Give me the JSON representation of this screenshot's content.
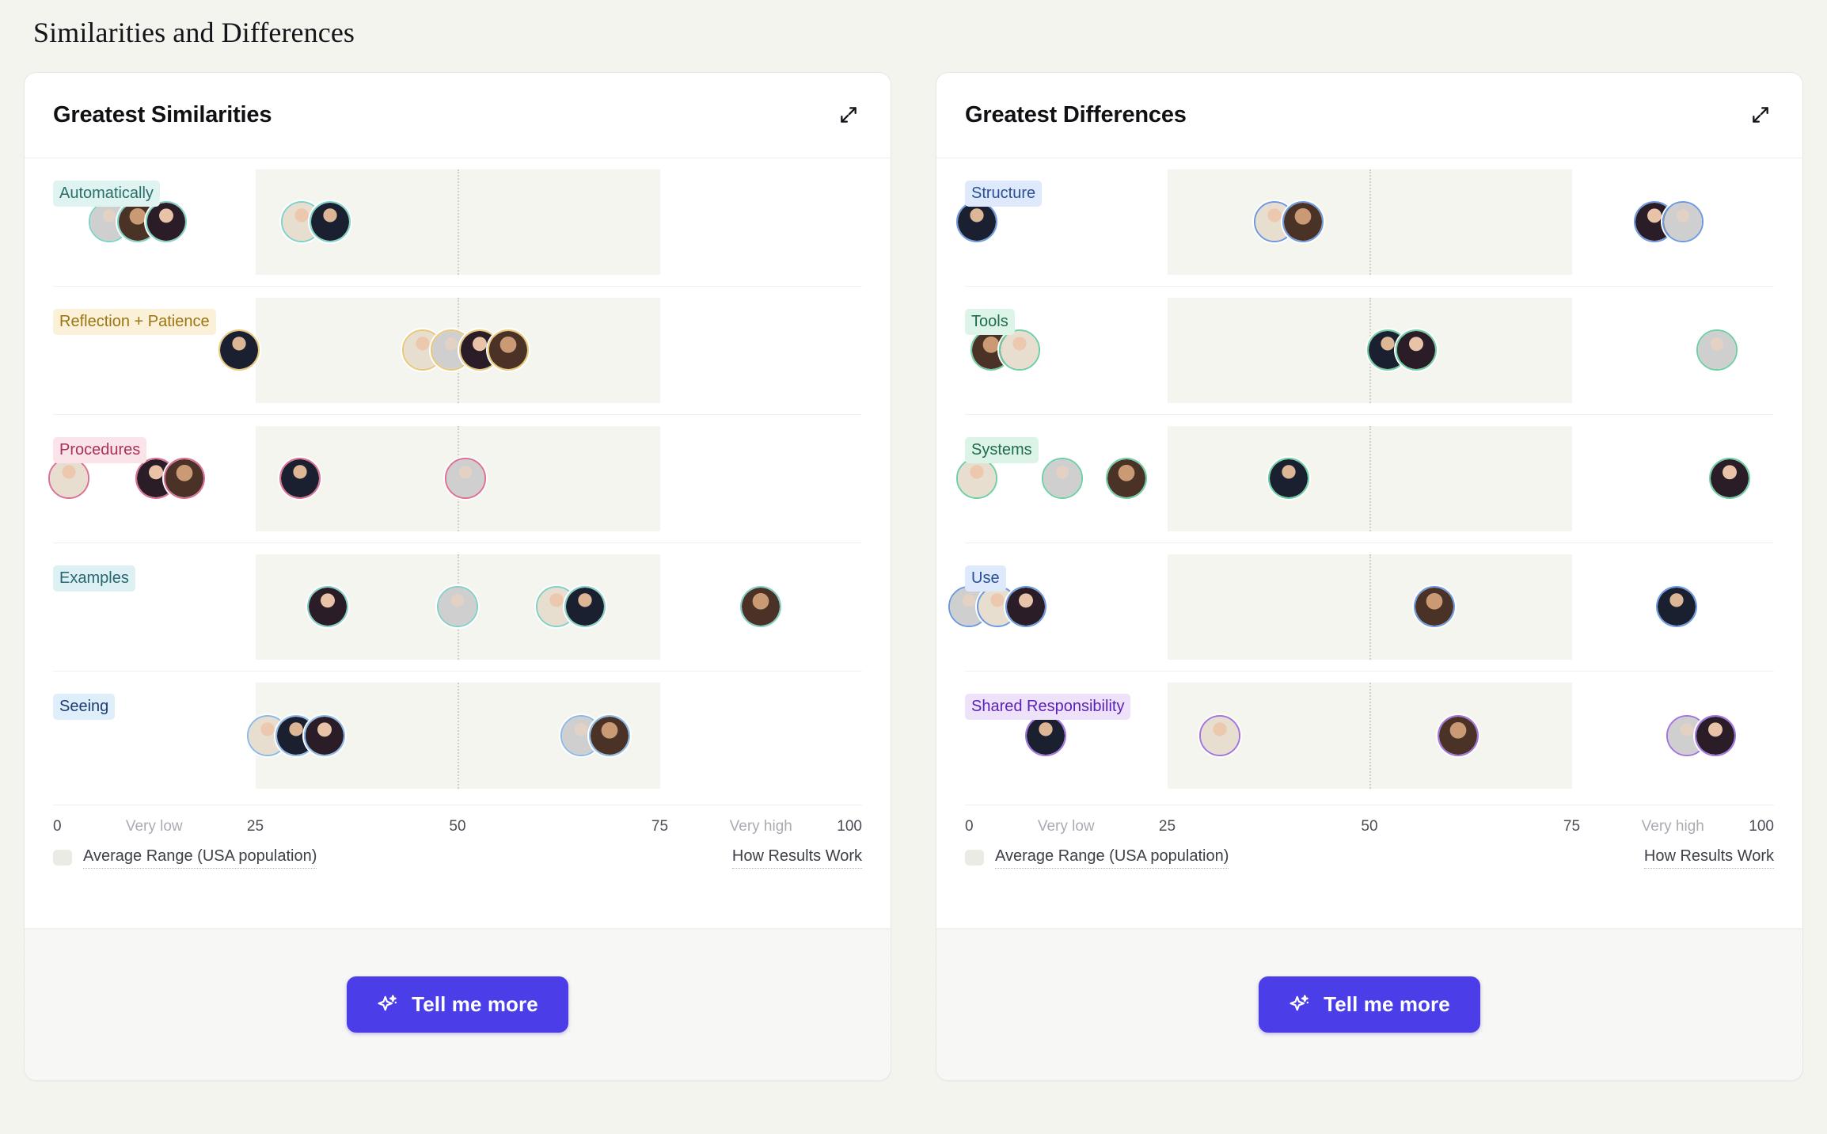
{
  "page": {
    "title": "Similarities and Differences"
  },
  "cards": [
    {
      "id": "greatest-similarities",
      "title": "Greatest Similarities",
      "expand_icon": "expand-diagonal-icon",
      "axis": {
        "ticks": [
          {
            "label": "0",
            "value": 0,
            "soft": false
          },
          {
            "label": "Very low",
            "value": 12.5,
            "soft": true
          },
          {
            "label": "25",
            "value": 25,
            "soft": false
          },
          {
            "label": "50",
            "value": 50,
            "soft": false
          },
          {
            "label": "75",
            "value": 75,
            "soft": false
          },
          {
            "label": "Very high",
            "value": 87.5,
            "soft": true
          },
          {
            "label": "100",
            "value": 100,
            "soft": false
          }
        ],
        "min": 0,
        "max": 100
      },
      "legend": {
        "swatch_label": "Average Range (USA population)",
        "how_link": "How Results Work"
      },
      "footer_button": {
        "label": "Tell me more",
        "icon": "sparkle-icon",
        "color": "#4b3ee8"
      },
      "rows": [
        {
          "label": "Automatically",
          "chip_bg": "#dff3f0",
          "chip_fg": "#2b6f6a",
          "ring": "#7fd2c6",
          "groups": [
            {
              "x": 10.5,
              "avatars": [
                "person-grey-suit",
                "person-man-beard",
                "person-woman-dark"
              ]
            },
            {
              "x": 32.5,
              "avatars": [
                "person-bride",
                "person-man-older"
              ]
            }
          ]
        },
        {
          "label": "Reflection + Patience",
          "chip_bg": "#fbf0d8",
          "chip_fg": "#9a7512",
          "ring": "#e8c878",
          "groups": [
            {
              "x": 23.0,
              "avatars": [
                "person-man-older"
              ]
            },
            {
              "x": 51.0,
              "avatars": [
                "person-bride",
                "person-grey-suit",
                "person-woman-dark",
                "person-man-beard"
              ]
            }
          ]
        },
        {
          "label": "Procedures",
          "chip_bg": "#fbe3ea",
          "chip_fg": "#a8325a",
          "ring": "#dd6f93",
          "groups": [
            {
              "x": 2.0,
              "avatars": [
                "person-bride"
              ]
            },
            {
              "x": 14.5,
              "avatars": [
                "person-woman-dark",
                "person-man-beard"
              ]
            },
            {
              "x": 30.5,
              "avatars": [
                "person-man-older"
              ]
            },
            {
              "x": 51.0,
              "avatars": [
                "person-grey-suit"
              ]
            }
          ]
        },
        {
          "label": "Examples",
          "chip_bg": "#ddf0f4",
          "chip_fg": "#27676f",
          "ring": "#84cfc4",
          "groups": [
            {
              "x": 34.0,
              "avatars": [
                "person-woman-dark"
              ]
            },
            {
              "x": 50.0,
              "avatars": [
                "person-grey-suit"
              ]
            },
            {
              "x": 64.0,
              "avatars": [
                "person-bride",
                "person-man-older"
              ]
            },
            {
              "x": 87.5,
              "avatars": [
                "person-man-beard"
              ]
            }
          ]
        },
        {
          "label": "Seeing",
          "chip_bg": "#dfeefb",
          "chip_fg": "#1f3c6e",
          "ring": "#8cb9e6",
          "groups": [
            {
              "x": 30.0,
              "avatars": [
                "person-bride",
                "person-man-older",
                "person-woman-dark"
              ]
            },
            {
              "x": 67.0,
              "avatars": [
                "person-grey-suit",
                "person-man-beard"
              ]
            }
          ]
        }
      ]
    },
    {
      "id": "greatest-differences",
      "title": "Greatest Differences",
      "expand_icon": "expand-diagonal-icon",
      "axis": {
        "ticks": [
          {
            "label": "0",
            "value": 0,
            "soft": false
          },
          {
            "label": "Very low",
            "value": 12.5,
            "soft": true
          },
          {
            "label": "25",
            "value": 25,
            "soft": false
          },
          {
            "label": "50",
            "value": 50,
            "soft": false
          },
          {
            "label": "75",
            "value": 75,
            "soft": false
          },
          {
            "label": "Very high",
            "value": 87.5,
            "soft": true
          },
          {
            "label": "100",
            "value": 100,
            "soft": false
          }
        ],
        "min": 0,
        "max": 100
      },
      "legend": {
        "swatch_label": "Average Range (USA population)",
        "how_link": "How Results Work"
      },
      "footer_button": {
        "label": "Tell me more",
        "icon": "sparkle-icon",
        "color": "#4b3ee8"
      },
      "rows": [
        {
          "label": "Structure",
          "chip_bg": "#deeafb",
          "chip_fg": "#2a4f96",
          "ring": "#6d9ade",
          "groups": [
            {
              "x": 1.5,
              "avatars": [
                "person-man-older"
              ]
            },
            {
              "x": 40.0,
              "avatars": [
                "person-bride",
                "person-man-beard"
              ]
            },
            {
              "x": 87.0,
              "avatars": [
                "person-woman-dark",
                "person-grey-suit"
              ]
            }
          ]
        },
        {
          "label": "Tools",
          "chip_bg": "#ddf4e9",
          "chip_fg": "#1f6b4c",
          "ring": "#6ecfa4",
          "groups": [
            {
              "x": 5.0,
              "avatars": [
                "person-man-beard",
                "person-bride"
              ]
            },
            {
              "x": 54.0,
              "avatars": [
                "person-man-older",
                "person-woman-dark"
              ]
            },
            {
              "x": 93.0,
              "avatars": [
                "person-grey-suit"
              ]
            }
          ]
        },
        {
          "label": "Systems",
          "chip_bg": "#dcf3e8",
          "chip_fg": "#1f6b4c",
          "ring": "#6ecfa4",
          "groups": [
            {
              "x": 1.5,
              "avatars": [
                "person-bride"
              ]
            },
            {
              "x": 12.0,
              "avatars": [
                "person-grey-suit"
              ]
            },
            {
              "x": 20.0,
              "avatars": [
                "person-man-beard"
              ]
            },
            {
              "x": 40.0,
              "avatars": [
                "person-man-older"
              ]
            },
            {
              "x": 94.5,
              "avatars": [
                "person-woman-dark"
              ]
            }
          ]
        },
        {
          "label": "Use",
          "chip_bg": "#deeafb",
          "chip_fg": "#2a4f96",
          "ring": "#6d9ade",
          "groups": [
            {
              "x": 4.0,
              "avatars": [
                "person-grey-suit",
                "person-bride",
                "person-woman-dark"
              ]
            },
            {
              "x": 58.0,
              "avatars": [
                "person-man-beard"
              ]
            },
            {
              "x": 88.0,
              "avatars": [
                "person-man-older"
              ]
            }
          ]
        },
        {
          "label": "Shared Responsibility",
          "chip_bg": "#eee2fb",
          "chip_fg": "#5b21b6",
          "ring": "#a274e0",
          "groups": [
            {
              "x": 10.0,
              "avatars": [
                "person-man-older"
              ]
            },
            {
              "x": 31.5,
              "avatars": [
                "person-bride"
              ]
            },
            {
              "x": 61.0,
              "avatars": [
                "person-man-beard"
              ]
            },
            {
              "x": 91.0,
              "avatars": [
                "person-grey-suit",
                "person-woman-dark"
              ]
            }
          ]
        }
      ]
    }
  ],
  "chart_data": {
    "type": "scatter",
    "title": "Similarities and Differences",
    "xlabel": "",
    "ylabel": "",
    "xlim": [
      0,
      100
    ],
    "grid": false,
    "legend": "bottom-left",
    "annotations": [
      "Average Range (USA population) band spans 25-75",
      "Dotted reference line at 50"
    ],
    "panels": [
      {
        "title": "Greatest Similarities",
        "categories": [
          "Automatically",
          "Reflection + Patience",
          "Procedures",
          "Examples",
          "Seeing"
        ],
        "series": [
          {
            "name": "Automatically",
            "x": [
              10.5,
              32.5
            ],
            "counts": [
              3,
              2
            ]
          },
          {
            "name": "Reflection + Patience",
            "x": [
              23.0,
              51.0
            ],
            "counts": [
              1,
              4
            ]
          },
          {
            "name": "Procedures",
            "x": [
              2.0,
              14.5,
              30.5,
              51.0
            ],
            "counts": [
              1,
              2,
              1,
              1
            ]
          },
          {
            "name": "Examples",
            "x": [
              34.0,
              50.0,
              64.0,
              87.5
            ],
            "counts": [
              1,
              1,
              2,
              1
            ]
          },
          {
            "name": "Seeing",
            "x": [
              30.0,
              67.0
            ],
            "counts": [
              3,
              2
            ]
          }
        ]
      },
      {
        "title": "Greatest Differences",
        "categories": [
          "Structure",
          "Tools",
          "Systems",
          "Use",
          "Shared Responsibility"
        ],
        "series": [
          {
            "name": "Structure",
            "x": [
              1.5,
              40.0,
              87.0
            ],
            "counts": [
              1,
              2,
              2
            ]
          },
          {
            "name": "Tools",
            "x": [
              5.0,
              54.0,
              93.0
            ],
            "counts": [
              2,
              2,
              1
            ]
          },
          {
            "name": "Systems",
            "x": [
              1.5,
              12.0,
              20.0,
              40.0,
              94.5
            ],
            "counts": [
              1,
              1,
              1,
              1,
              1
            ]
          },
          {
            "name": "Use",
            "x": [
              4.0,
              58.0,
              88.0
            ],
            "counts": [
              3,
              1,
              1
            ]
          },
          {
            "name": "Shared Responsibility",
            "x": [
              10.0,
              31.5,
              61.0,
              91.0
            ],
            "counts": [
              1,
              1,
              1,
              2
            ]
          }
        ]
      }
    ]
  }
}
